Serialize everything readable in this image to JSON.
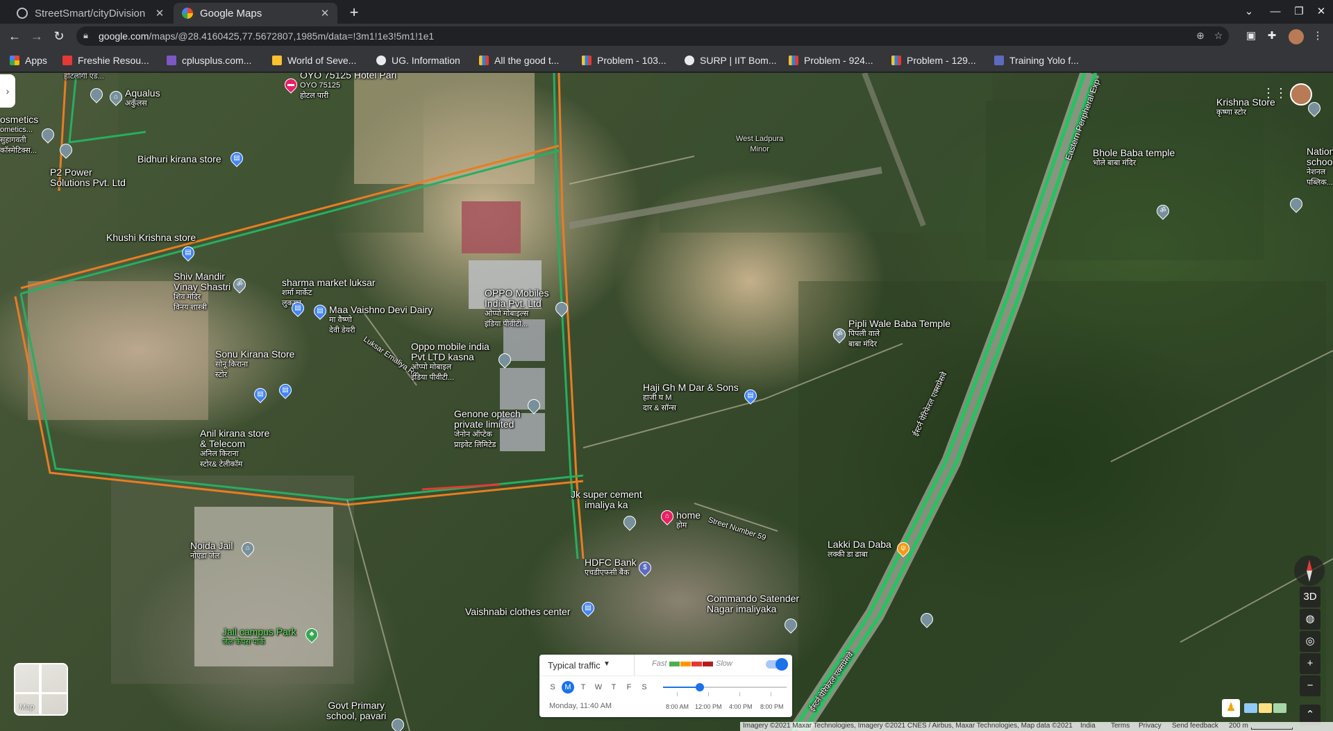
{
  "browser": {
    "tabs": [
      {
        "title": "StreetSmart/cityDivision",
        "active": false
      },
      {
        "title": "Google Maps",
        "active": true
      }
    ],
    "url_host": "google.com",
    "url_path": "/maps/@28.4160425,77.5672807,1985m/data=!3m1!1e3!5m1!1e1",
    "bookmarks": [
      "Apps",
      "Freshie Resou...",
      "cplusplus.com...",
      "World of Seve...",
      "UG. Information",
      "All the good t...",
      "Problem - 103...",
      "SURP | IIT Bom...",
      "Problem - 924...",
      "Problem - 129...",
      "Training Yolo f..."
    ]
  },
  "map": {
    "places": {
      "oyo": {
        "name": "OYO 75125 Hotel Pari",
        "sub": "OYO 75125",
        "sub2": "होटल पारी"
      },
      "aqualus": {
        "name": "Aqualus",
        "sub": "अकुँलस"
      },
      "hotel_top": {
        "name": "होटलोगी एंड..."
      },
      "cosmetics": {
        "name": "osmetics",
        "sub": "ometics...",
        "sub2": "सुहागवती",
        "sub3": "कॉस्मेटिक्स..."
      },
      "p2power": {
        "name": "P2 Power",
        "sub": "Solutions Pvt. Ltd"
      },
      "bidhuri": {
        "name": "Bidhuri kirana store"
      },
      "khushi": {
        "name": "Khushi Krishna store"
      },
      "shiv_mandir": {
        "name": "Shiv Mandir",
        "sub": "Vinay Shastri",
        "sub2": "शिव मंदिर",
        "sub3": "विनय शास्त्री"
      },
      "sharma": {
        "name": "sharma market luksar",
        "sub": "शर्मा मार्केट",
        "sub2": "लुकसर"
      },
      "maa_vaishno": {
        "name": "Maa Vaishno Devi Dairy",
        "sub": "मा वैष्णो",
        "sub2": "देवी डेयरी"
      },
      "oppo_mobiles": {
        "name": "OPPO Mobiles",
        "sub": "India Pvt. Ltd",
        "sub2": "ओप्पो मोबाइल्स",
        "sub3": "इंडिया पीवीटी..."
      },
      "oppo_kasna": {
        "name": "Oppo mobile india",
        "sub": "Pvt LTD kasna",
        "sub2": "ओप्पो मोबाइल",
        "sub3": "इंडिया पीवीटी..."
      },
      "sonu": {
        "name": "Sonu Kirana Store",
        "sub": "सोनू किराना",
        "sub2": "स्टोर"
      },
      "anil": {
        "name": "Anil kirana store",
        "sub": "& Telecom",
        "sub2": "अनिल किराना",
        "sub3": "स्टोर& टेलीकॉम"
      },
      "genone": {
        "name": "Genone optech",
        "sub": "private limited",
        "sub2": "जेनोन ऑप्टेक",
        "sub3": "प्राइवेट लिमिटेड"
      },
      "west_ladpura": {
        "name": "West Ladpura",
        "sub": "Minor"
      },
      "haji": {
        "name": "Haji Gh M Dar & Sons",
        "sub": "हाजी घ M",
        "sub2": "दार & सॉन्स"
      },
      "pipli": {
        "name": "Pipli Wale Baba Temple",
        "sub": "पिपली वाले",
        "sub2": "बाबा मंदिर"
      },
      "krishna": {
        "name": "Krishna Store",
        "sub": "कृष्णा स्टोर"
      },
      "bhole": {
        "name": "Bhole Baba temple",
        "sub": "भोले बाबा मंदिर"
      },
      "national": {
        "name": "Nation",
        "sub": "schoo",
        "sub2": "नेशनल",
        "sub3": "पब्लिक..."
      },
      "jk_cement": {
        "name": "Jk super cement",
        "sub": "imaliya ka"
      },
      "home": {
        "name": "home",
        "sub": "होम"
      },
      "hdfc": {
        "name": "HDFC Bank",
        "sub": "एचडीएफसी बैंक"
      },
      "noida_jail": {
        "name": "Noida Jail",
        "sub": "नोएडा जेल"
      },
      "vaishnabi": {
        "name": "Vaishnabi clothes center"
      },
      "commando": {
        "name": "Commando Satender",
        "sub": "Nagar imaliyaka"
      },
      "lakki": {
        "name": "Lakki Da Daba",
        "sub": "लक्की डा ढाबा"
      },
      "jail_park": {
        "name": "Jail campus Park",
        "sub": "जेल कैंपस पार्क"
      },
      "govt_school": {
        "name": "Govt Primary",
        "sub": "school, pavari"
      }
    },
    "roads": {
      "luksar": "Luksar Emaliya Rd",
      "street59": "Street Number 59",
      "eastern_top": "Eastern Peripheral Exp",
      "eastern_hi": "ईस्टर्न पेरिफेरल एक्सप्रेसवे",
      "eastern_hi2": "ईस्टर्न पेरिफेरल एक्सप्रेसवे"
    },
    "layer_label": "Map",
    "controls": {
      "tilt": "3D"
    }
  },
  "traffic": {
    "mode": "Typical traffic",
    "fast": "Fast",
    "slow": "Slow",
    "legend_colors": [
      "#4caf50",
      "#ff9800",
      "#e53935",
      "#b71c1c"
    ],
    "days": [
      "S",
      "M",
      "T",
      "W",
      "T",
      "F",
      "S"
    ],
    "selected_day": "M",
    "when": "Monday, 11:40 AM",
    "times": [
      "8:00 AM",
      "12:00 PM",
      "4:00 PM",
      "8:00 PM"
    ],
    "slider_fraction": 0.3
  },
  "footer": {
    "imagery": "Imagery ©2021 Maxar Technologies, Imagery ©2021 CNES / Airbus, Maxar Technologies, Map data ©2021",
    "india": "India",
    "terms": "Terms",
    "privacy": "Privacy",
    "feedback": "Send feedback",
    "scale": "200 m"
  }
}
